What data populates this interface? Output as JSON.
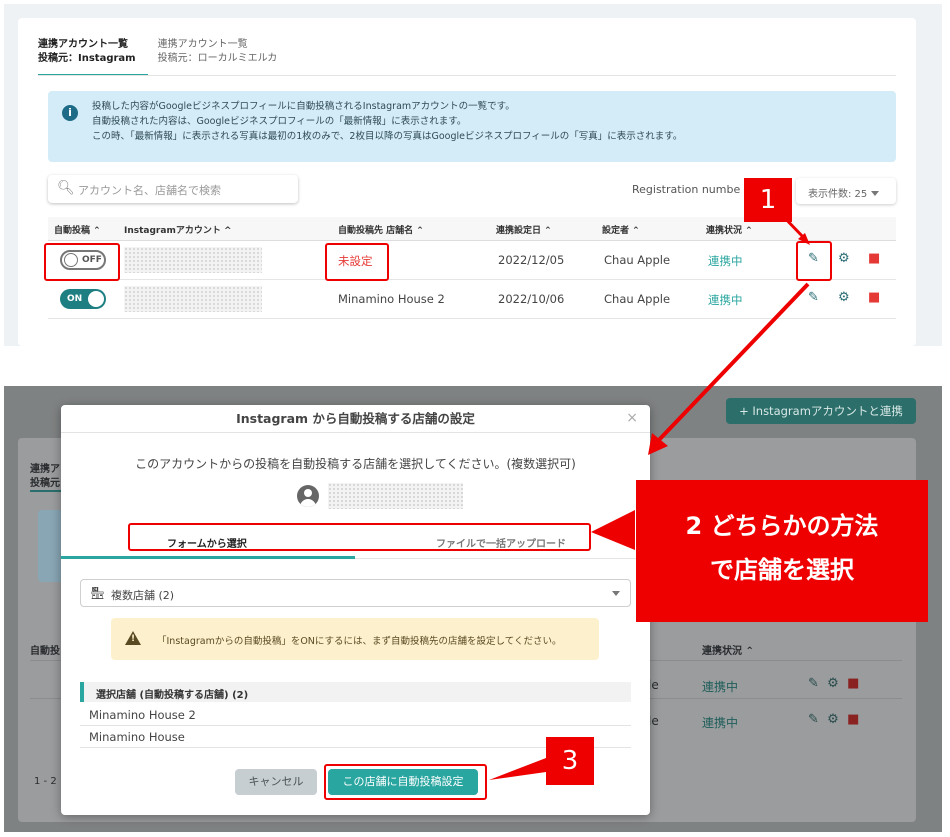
{
  "top": {
    "tabs": [
      {
        "title": "連携アカウント一覧",
        "subtitle": "投稿元：Instagram"
      },
      {
        "title": "連携アカウント一覧",
        "subtitle": "投稿元：ローカルミエルカ"
      }
    ],
    "info_icon": "info-icon",
    "info_lines": [
      "投稿した内容がGoogleビジネスプロフィールに自動投稿されるInstagramアカウントの一覧です。",
      "自動投稿された内容は、Googleビジネスプロフィールの「最新情報」に表示されます。",
      "この時、「最新情報」に表示される写真は最初の1枚のみで、2枚目以降の写真はGoogleビジネスプロフィールの「写真」に表示されます。"
    ],
    "search_placeholder": "アカウント名、店舗名で検索",
    "registration_label": "Registration numbe",
    "per_page": "表示件数: 25",
    "columns": [
      "自動投稿 ⌃",
      "Instagramアカウント ^",
      "自動投稿先 店舗名 ⌃",
      "連携設定日 ⌃",
      "設定者 ⌃",
      "連携状況 ⌃"
    ],
    "rows": [
      {
        "toggle": "OFF",
        "store": "未設定",
        "date": "2022/12/05",
        "setter": "Chau Apple",
        "status": "連携中"
      },
      {
        "toggle": "ON",
        "store": "Minamino House 2",
        "date": "2022/10/06",
        "setter": "Chau Apple",
        "status": "連携中"
      }
    ]
  },
  "background": {
    "add_button": "+ Instagramアカウントと連携",
    "tab_title": "連携アカ",
    "tab_subtitle": "投稿元：",
    "col_auto": "自動投",
    "col_status": "連携状況 ⌃",
    "row_setter_tail": "le",
    "row_status": "連携中",
    "pagination": "1 - 2"
  },
  "modal": {
    "title": "Instagram から自動投稿する店舗の設定",
    "close": "×",
    "description": "このアカウントからの投稿を自動投稿する店舗を選択してください。(複数選択可)",
    "tabs": [
      "フォームから選択",
      "ファイルで一括アップロード"
    ],
    "select_value": "複数店舗 (2)",
    "warning": "「Instagramからの自動投稿」をONにするには、まず自動投稿先の店舗を設定してください。",
    "selected_header": "選択店舗 (自動投稿する店舗)  (2)",
    "selected_items": [
      "Minamino House 2",
      "Minamino House"
    ],
    "cancel": "キャンセル",
    "confirm": "この店舗に自動投稿設定"
  },
  "annotations": {
    "step1": "1",
    "step2_line1": "2 どちらかの方法",
    "step2_line2": "で店舗を選択",
    "step3": "3",
    "accent_color": "#e00000"
  }
}
